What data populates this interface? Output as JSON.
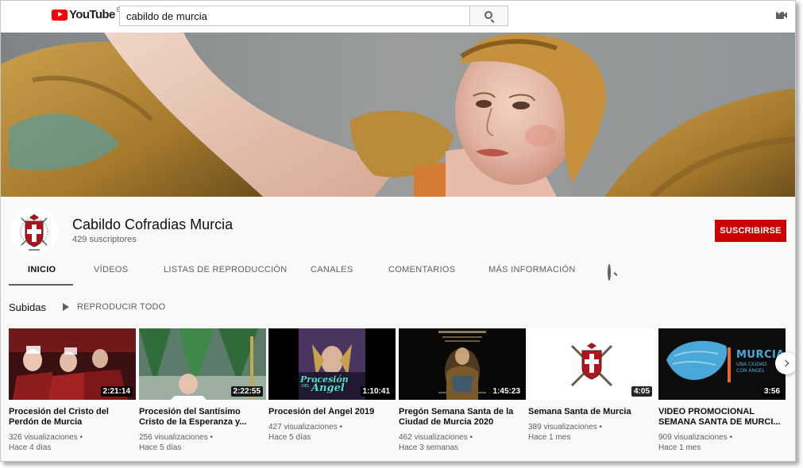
{
  "masthead": {
    "logo_text": "YouTube",
    "logo_region": "ES",
    "search_query": "cabildo de murcia"
  },
  "channel": {
    "name": "Cabildo Cofradias Murcia",
    "subscribers": "429 suscriptores",
    "subscribe_label": "SUSCRIBIRSE"
  },
  "tabs": [
    {
      "label": "INICIO",
      "active": true
    },
    {
      "label": "VÍDEOS"
    },
    {
      "label": "LISTAS DE REPRODUCCIÓN"
    },
    {
      "label": "CANALES"
    },
    {
      "label": "COMENTARIOS"
    },
    {
      "label": "MÁS INFORMACIÓN"
    }
  ],
  "section": {
    "title": "Subidas",
    "play_all": "REPRODUCIR TODO"
  },
  "videos": [
    {
      "title": "Procesión del Cristo del Perdón de Murcia",
      "duration": "2:21:14",
      "views": "326 visualizaciones •",
      "age": "Hace 4 días"
    },
    {
      "title": "Procesión del Santísimo Cristo de la Esperanza y...",
      "duration": "2:22:55",
      "views": "256 visualizaciones •",
      "age": "Hace 5 días"
    },
    {
      "title": "Procesión del Ángel 2019",
      "duration": "1:10:41",
      "views": "427 visualizaciones •",
      "age": "Hace 5 días",
      "thumb_text_1": "Procesión",
      "thumb_text_2": "Ángel",
      "thumb_text_small": "DEL"
    },
    {
      "title": "Pregón Semana Santa de la Ciudad de Murcia 2020",
      "duration": "1:45:23",
      "views": "462 visualizaciones •",
      "age": "Hace 3 semanas"
    },
    {
      "title": "Semana Santa de Murcia",
      "duration": "4:05",
      "views": "389 visualizaciones •",
      "age": "Hace 1 mes"
    },
    {
      "title": "VIDEO PROMOCIONAL SEMANA SANTA DE MURCI...",
      "duration": "3:56",
      "views": "909 visualizaciones •",
      "age": "Hace 1 mes",
      "thumb_text_1": "MURCIA",
      "thumb_text_2": "UNA CIUDAD",
      "thumb_text_3": "CON ÁNGEL"
    }
  ],
  "icons": {
    "search": "search-icon",
    "camera": "video-camera-add-icon",
    "next": "chevron-right-icon",
    "play": "play-icon"
  },
  "colors": {
    "brand_red": "#ff0000",
    "subscribe_red": "#cc0000",
    "text_primary": "#0f0f0f",
    "text_secondary": "#606060"
  }
}
